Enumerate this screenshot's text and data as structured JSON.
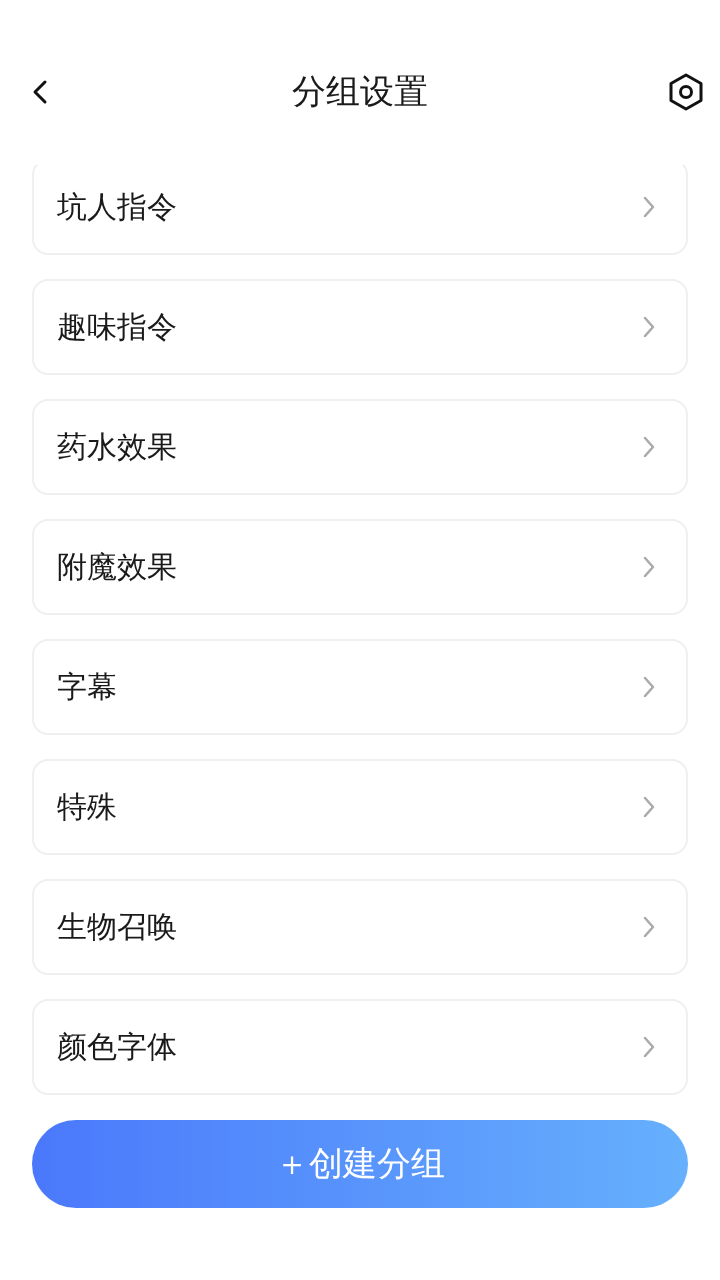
{
  "header": {
    "title": "分组设置"
  },
  "groups": [
    {
      "name": "坑人指令"
    },
    {
      "name": "趣味指令"
    },
    {
      "name": "药水效果"
    },
    {
      "name": "附魔效果"
    },
    {
      "name": "字幕"
    },
    {
      "name": "特殊"
    },
    {
      "name": "生物召唤"
    },
    {
      "name": "颜色字体"
    }
  ],
  "create_button": {
    "label": "＋创建分组"
  }
}
